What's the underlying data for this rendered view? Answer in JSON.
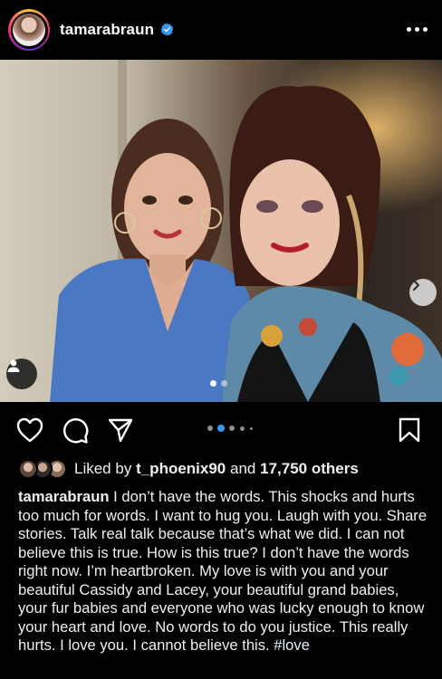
{
  "post": {
    "username": "tamarabraun",
    "verified": true
  },
  "icons": {
    "verified": "verified-badge-icon",
    "more": "more-options-icon",
    "next": "chevron-right-icon",
    "tag": "user-tag-icon",
    "like": "heart-icon",
    "comment": "comment-icon",
    "share": "send-icon",
    "save": "bookmark-icon"
  },
  "likes": {
    "prefix": "Liked by",
    "user": "t_phoenix90",
    "joiner": "and",
    "others": "17,750 others"
  },
  "caption": {
    "author": "tamarabraun",
    "text": "I don’t have the words. This shocks and hurts too much for words. I want to hug you. Laugh with you. Share stories. Talk real talk because that’s what we did. I can not believe this is true. How is this true? I don’t have the words right now. I’m heartbroken. My love is with you and your beautiful Cassidy and Lacey, your beautiful grand babies, your fur babies and everyone who was lucky enough to know your heart and love. No words to do you justice. This really hurts. I love you. I cannot believe this.",
    "hashtag": "#love"
  },
  "carousel": {
    "photo_index": 1,
    "photo_count": 2
  },
  "colors": {
    "background": "#000000",
    "text": "#f5f5f5",
    "verified": "#3897f0",
    "active_dot": "#3897f0",
    "inactive_dot": "#8e8e8e"
  }
}
